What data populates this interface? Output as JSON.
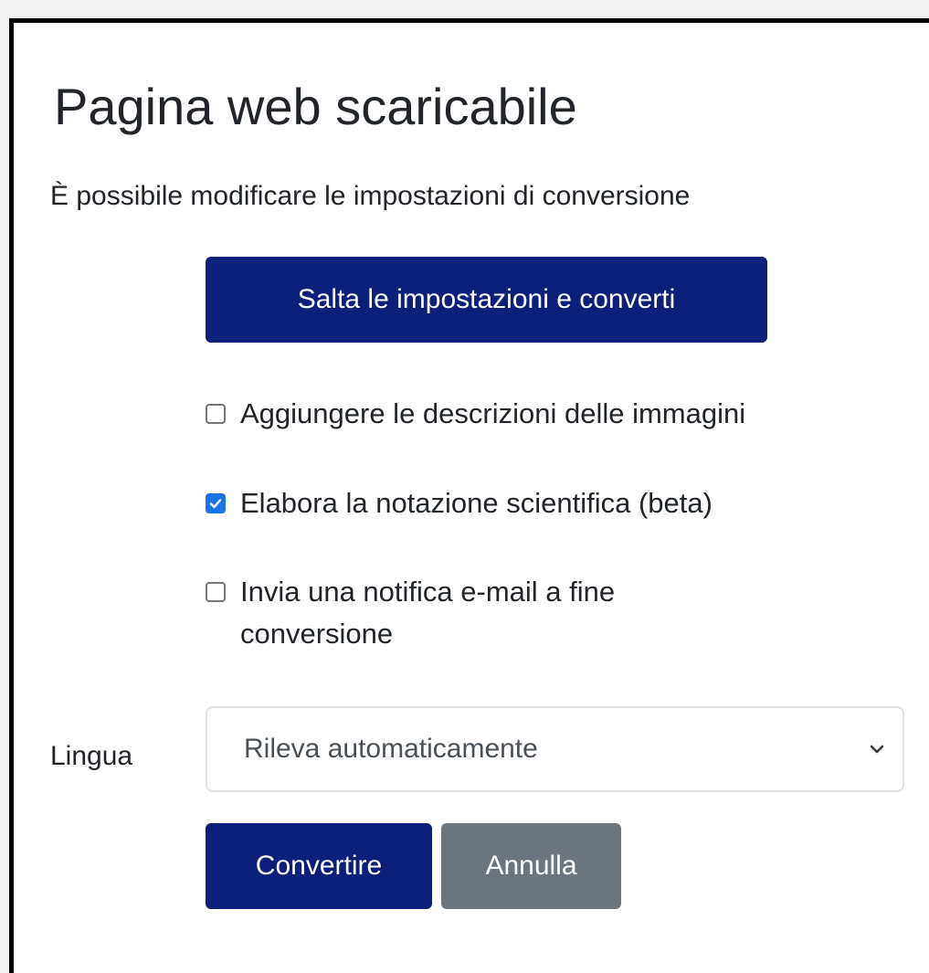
{
  "dialog": {
    "title": "Pagina web scaricabile",
    "subtitle": "È possibile modificare le impostazioni di conversione",
    "skip_button": "Salta le impostazioni e converti",
    "options": [
      {
        "label": "Aggiungere le descrizioni delle immagini",
        "checked": false
      },
      {
        "label": "Elabora la notazione scientifica (beta)",
        "checked": true
      },
      {
        "label": "Invia una notifica e-mail a fine conversione",
        "checked": false
      }
    ],
    "language": {
      "label": "Lingua",
      "selected": "Rileva automaticamente"
    },
    "convert_button": "Convertire",
    "cancel_button": "Annulla"
  },
  "colors": {
    "primary": "#0b1f7b",
    "secondary": "#6c757d",
    "checkbox_checked": "#1a73e8"
  },
  "icons": {
    "checkmark": "checkmark-icon",
    "dropdown": "chevron-down-icon"
  }
}
